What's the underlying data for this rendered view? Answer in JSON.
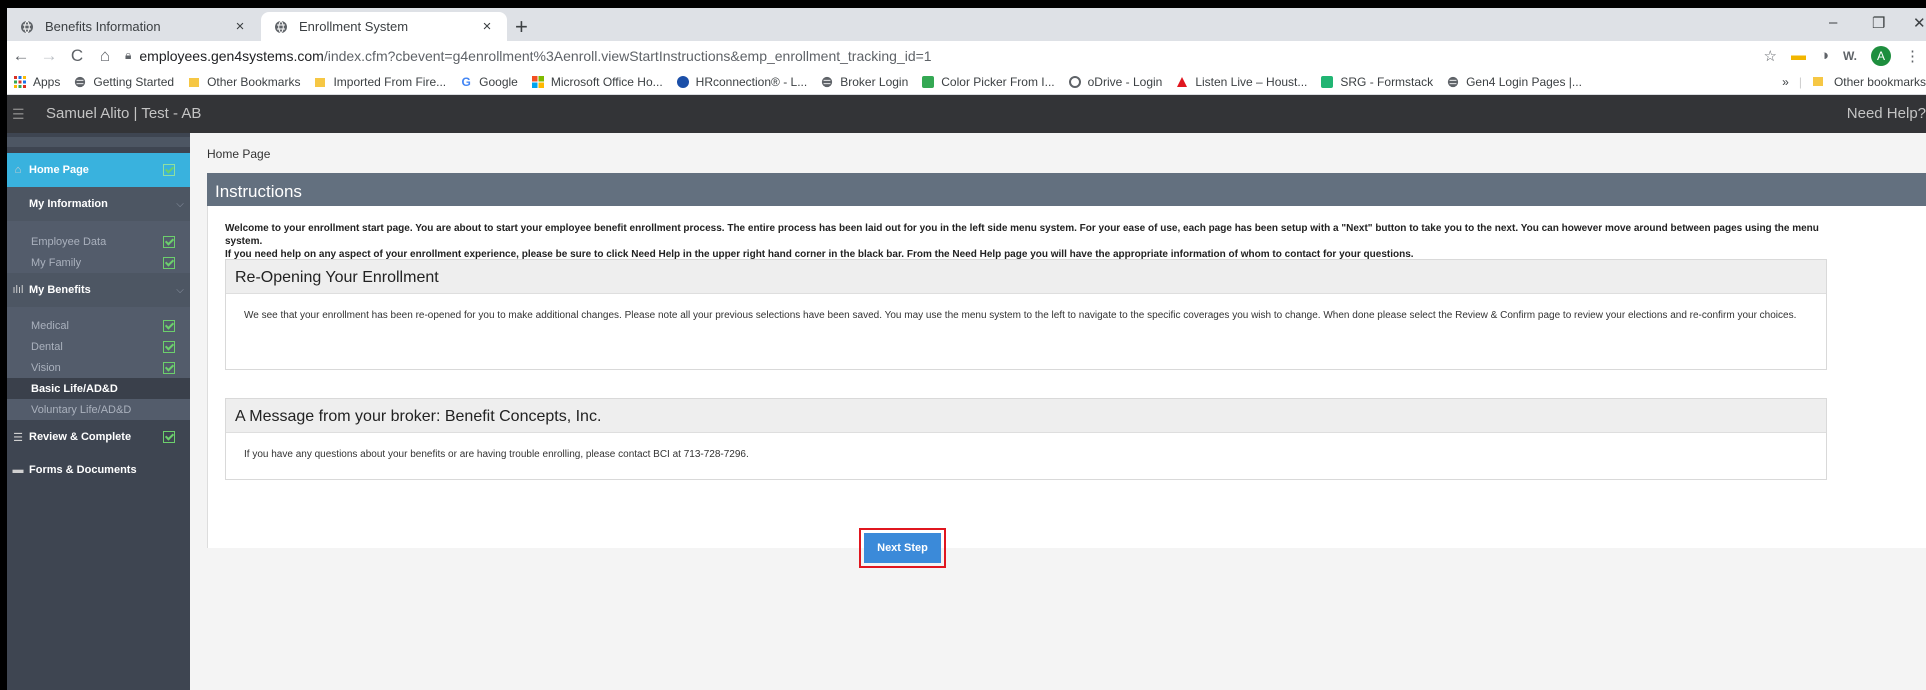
{
  "browser": {
    "tabs": [
      {
        "title": "Benefits Information",
        "close": "×"
      },
      {
        "title": "Enrollment System",
        "close": "×"
      }
    ],
    "new_tab": "+",
    "window": {
      "minimize": "–",
      "restore": "❐",
      "close": "✕"
    },
    "url": {
      "host": "employees.gen4systems.com",
      "path": "/index.cfm?cbevent=g4enrollment%3Aenroll.viewStartInstructions&emp_enrollment_tracking_id=1"
    },
    "profile_initial": "A",
    "bookmarks": [
      {
        "label": "Apps",
        "icon": "apps-grid-icon"
      },
      {
        "label": "Getting Started",
        "icon": "globe-icon"
      },
      {
        "label": "Other Bookmarks",
        "icon": "folder-icon"
      },
      {
        "label": "Imported From Fire...",
        "icon": "folder-icon"
      },
      {
        "label": "Google",
        "icon": "google-icon"
      },
      {
        "label": "Microsoft Office Ho...",
        "icon": "microsoft-icon"
      },
      {
        "label": "HRconnection® - L...",
        "icon": "hrconnection-icon"
      },
      {
        "label": "Broker Login",
        "icon": "globe-icon"
      },
      {
        "label": "Color Picker From I...",
        "icon": "color-picker-icon"
      },
      {
        "label": "oDrive - Login",
        "icon": "odrive-icon"
      },
      {
        "label": "Listen Live – Houst...",
        "icon": "radio-icon"
      },
      {
        "label": "SRG - Formstack",
        "icon": "formstack-icon"
      },
      {
        "label": "Gen4 Login Pages |...",
        "icon": "globe-icon"
      }
    ],
    "bookmarks_overflow": "»",
    "other_bookmarks": "Other bookmarks"
  },
  "header": {
    "user": "Samuel Alito | Test - AB",
    "need_help": "Need Help?"
  },
  "sidebar": {
    "home": "Home Page",
    "my_information": "My Information",
    "info_items": [
      "Employee Data",
      "My Family"
    ],
    "my_benefits": "My Benefits",
    "benefit_items": [
      "Medical",
      "Dental",
      "Vision",
      "Basic Life/AD&D",
      "Voluntary Life/AD&D"
    ],
    "review": "Review & Complete",
    "forms": "Forms & Documents"
  },
  "main": {
    "breadcrumb": "Home Page",
    "panel_title": "Instructions",
    "intro_line1": "Welcome to your enrollment start page. You are about to start your employee benefit enrollment process. The entire process has been laid out for you in the left side menu system. For your ease of use, each page has been setup with a \"Next\" button to take you to the next. You can however move around between pages using the menu system.",
    "intro_line2": "If you need help on any aspect of your enrollment experience, please be sure to click Need Help in the upper right hand corner in the black bar. From the Need Help page you will have the appropriate information of whom to contact for your questions.",
    "reopen_title": "Re-Opening Your Enrollment",
    "reopen_text": "We see that your enrollment has been re-opened for you to make additional changes. Please note all your previous selections have been saved. You may use the menu system to the left to navigate to the specific coverages you wish to change. When done please select the Review & Confirm page to review your elections and re-confirm your choices.",
    "broker_title": "A Message from your broker: Benefit Concepts, Inc.",
    "broker_text": "If you have any questions about your benefits or are having trouble enrolling, please contact BCI at 713-728-7296.",
    "next_step": "Next Step"
  },
  "colors": {
    "sidebar_active": "#39b2de",
    "panel_header": "#63707f",
    "next_button": "#3b8ad9",
    "highlight": "#e0161f"
  }
}
